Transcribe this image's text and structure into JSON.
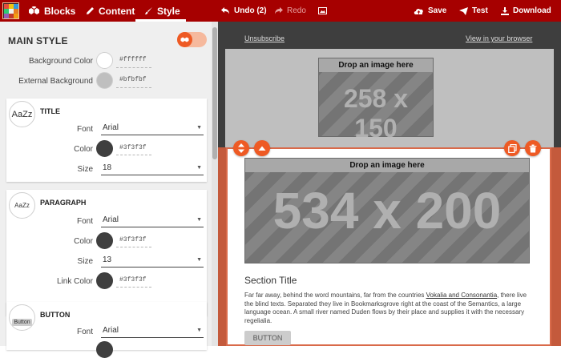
{
  "toolbar": {
    "tabs": [
      {
        "label": "Blocks"
      },
      {
        "label": "Content"
      },
      {
        "label": "Style"
      }
    ],
    "undo_label": "Undo (2)",
    "redo_label": "Redo",
    "save_label": "Save",
    "test_label": "Test",
    "download_label": "Download",
    "active_tab": "Style"
  },
  "style_panel": {
    "main_title": "MAIN STYLE",
    "background_color": {
      "label": "Background Color",
      "value": "#ffffff"
    },
    "external_background": {
      "label": "External Background",
      "value": "#bfbfbf"
    },
    "title_card": {
      "heading": "TITLE",
      "avatar_text": "AaZz",
      "font": {
        "label": "Font",
        "value": "Arial"
      },
      "color": {
        "label": "Color",
        "value": "#3f3f3f"
      },
      "size": {
        "label": "Size",
        "value": "18"
      }
    },
    "paragraph_card": {
      "heading": "PARAGRAPH",
      "avatar_text": "AaZz",
      "font": {
        "label": "Font",
        "value": "Arial"
      },
      "color": {
        "label": "Color",
        "value": "#3f3f3f"
      },
      "size": {
        "label": "Size",
        "value": "13"
      },
      "link_color": {
        "label": "Link Color",
        "value": "#3f3f3f"
      }
    },
    "button_card": {
      "heading": "BUTTON",
      "avatar_text": "Button",
      "font": {
        "label": "Font",
        "value": "Arial"
      }
    }
  },
  "preview": {
    "unsubscribe": "Unsubscribe",
    "view_in_browser": "View in your browser",
    "top_image": {
      "drop_text": "Drop an image here",
      "dims": "258 x 150"
    },
    "main_image": {
      "drop_text": "Drop an image here",
      "dims": "534 x 200"
    },
    "section_title": "Section Title",
    "body_before_link": "Far far away, behind the word mountains, far from the countries ",
    "body_link": "Vokalia and Consonantia",
    "body_after_link": ", there live the blind texts. Separated they live in Bookmarksgrove right at the coast of the Semantics, a large language ocean. A small river named Duden flows by their place and supplies it with the necessary regelialia.",
    "button_label": "BUTTON"
  },
  "colors": {
    "toolbar": "#a60000",
    "accent": "#ee5a24",
    "panel_bg": "#efefef",
    "preview_bg": "#3e3e3e",
    "swatch_dark": "#3f3f3f"
  },
  "icons": {
    "logo": "mosaico-logo",
    "blocks": "cubes-icon",
    "content": "pencil-icon",
    "style": "paintbrush-icon",
    "undo": "undo-icon",
    "redo": "redo-icon",
    "gallery": "image-icon",
    "save": "cloud-upload-icon",
    "test": "paper-plane-icon",
    "download": "download-icon"
  }
}
